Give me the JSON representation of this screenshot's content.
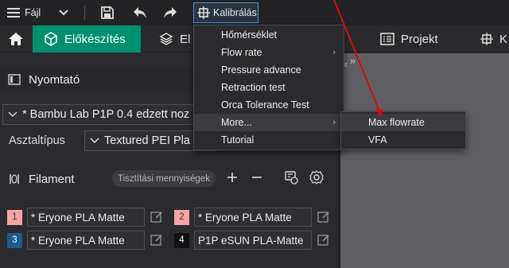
{
  "menubar": {
    "file_label": "Fájl",
    "calibration_label": "Kalibrálás"
  },
  "tabs": {
    "active_label": "Előkészítés",
    "preview_label_partial": "El",
    "project_label": "Projekt",
    "right_partial": "K"
  },
  "printer": {
    "section_title": "Nyomtató",
    "selected_printer": "* Bambu Lab P1P 0.4 edzett noz",
    "plate_label": "Asztaltípus",
    "plate_value": "Textured PEI Pla"
  },
  "filament": {
    "section_title": "Filament",
    "flush_button": "Tisztítási mennyiségek",
    "slots": [
      {
        "index": "1",
        "name": "* Eryone PLA Matte",
        "color": "#f4a4a4",
        "text_color": "#333333"
      },
      {
        "index": "2",
        "name": "* Eryone PLA Matte",
        "color": "#f4a4a4",
        "text_color": "#333333"
      },
      {
        "index": "3",
        "name": "* Eryone PLA Matte",
        "color": "#1e5a8c",
        "text_color": "#ffffff"
      },
      {
        "index": "4",
        "name": "P1P eSUN PLA-Matte",
        "color": "#111111",
        "text_color": "#ffffff"
      }
    ]
  },
  "calibration_menu": {
    "items": [
      "Hőmérséklet",
      "Flow rate",
      "Pressure advance",
      "Retraction test",
      "Orca Tolerance Test",
      "More...",
      "Tutorial"
    ]
  },
  "more_submenu": {
    "items": [
      "Max flowrate",
      "VFA"
    ]
  },
  "colors": {
    "accent_green": "#00906f",
    "highlight_blue": "#4a90e2",
    "pointer_red": "#cc1111"
  }
}
